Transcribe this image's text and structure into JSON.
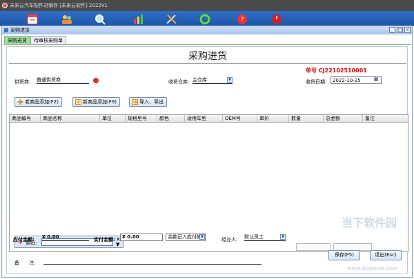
{
  "app": {
    "title": "未来云汽车配件进销存 [未来云软件] 2022V1"
  },
  "toolbar": {
    "icons": [
      "calendar-icon",
      "users-icon",
      "search-icon",
      "chart-icon",
      "tools-icon",
      "recycle-icon",
      "help-icon",
      "power-icon"
    ]
  },
  "window": {
    "title": "采购进货",
    "controls": [
      "_",
      "□",
      "×"
    ]
  },
  "tabs": [
    {
      "label": "采购进货",
      "active": true
    },
    {
      "label": "待审核采购单",
      "active": false
    }
  ],
  "form": {
    "heading": "采购进货",
    "order_no": "单号 CJ22102510001",
    "supplier_label": "供货商:",
    "supplier_value": "普通供货商",
    "warehouse_label": "收货仓库:",
    "warehouse_value": "主仓库",
    "date_label": "收货日期:",
    "date_value": "2022-10-25"
  },
  "actions": {
    "old_product": "老商品添加(F2)",
    "new_product": "新商品添加(F9)",
    "import_export": "导入、导出"
  },
  "grid": {
    "columns": [
      "商品编号",
      "商品名称",
      "单位",
      "规格型号",
      "颜色",
      "适用车型",
      "OEM号",
      "单价",
      "数量",
      "总金额",
      "备注"
    ]
  },
  "barcode": {
    "label": "条码:",
    "value": ""
  },
  "footer": {
    "payable_label": "应付金额:",
    "payable_value": "¥ 0.00",
    "paid_label": "实付金额:",
    "paid_value": "¥ 0.00",
    "balance_option": "余款记入应付帐",
    "handler_label": "经办人:",
    "handler_value": "默认员工",
    "remark_label": "备　　注:",
    "remark_value": "",
    "save_button": "保存(F5)",
    "exit_button": "退出(Esc)"
  },
  "watermark": {
    "text1": "当下软件园",
    "text2": "www.downxia.com"
  },
  "colors": {
    "toolbar": "#1e55a5",
    "active_tab": "#9fe09f",
    "order_no": "#dd0000"
  }
}
